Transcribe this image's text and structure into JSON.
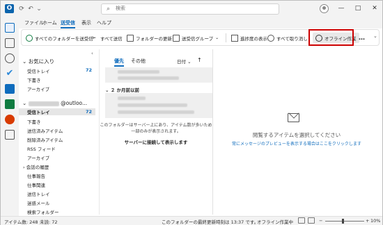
{
  "menu": [
    "ファイル",
    "ホーム",
    "送受信",
    "表示",
    "ヘルプ"
  ],
  "search": {
    "placeholder": "検索"
  },
  "ribbon": {
    "send_receive_all": "すべてのフォルダーを送受信",
    "send_all": "すべて送信",
    "update_folder": "フォルダーの更新",
    "send_receive_group": "送受信グループ",
    "show_progress": "進捗度の表示",
    "cancel_all": "すべて取り消し",
    "work_offline": "オフライン作業",
    "more": "…"
  },
  "folders": {
    "favorites_header": "お気に入り",
    "favorites": [
      {
        "label": "受信トレイ",
        "count": "72"
      },
      {
        "label": "下書き",
        "count": ""
      },
      {
        "label": "アーカイブ",
        "count": ""
      }
    ],
    "account_suffix": "@outloo...",
    "account_items": [
      {
        "label": "受信トレイ",
        "count": "72"
      },
      {
        "label": "下書き"
      },
      {
        "label": "送信済みアイテム"
      },
      {
        "label": "削除済みアイテム"
      },
      {
        "label": "RSS フィード"
      },
      {
        "label": "アーカイブ"
      },
      {
        "label": "会話の履歴"
      },
      {
        "label": "仕事報告"
      },
      {
        "label": "仕事関連"
      },
      {
        "label": "送信トレイ"
      },
      {
        "label": "迷惑メール"
      },
      {
        "label": "検索フォルダー"
      }
    ]
  },
  "list": {
    "tab_focused": "優先",
    "tab_other": "その他",
    "sort": "日付",
    "section_two_months": "２ か月前以前",
    "note_line1": "このフォルダーはサーバー上にあり、アイテム数が多いため",
    "note_line2": "一部のみが表示されます。",
    "connect": "サーバーに接続して表示します"
  },
  "reading": {
    "title": "閲覧するアイテムを選択してください",
    "link": "常にメッセージのプレビューを表示する場合はここをクリックします"
  },
  "status": {
    "items": "アイテム数: 248",
    "unread": "未読: 72",
    "last_update": "このフォルダーの最終更新時刻は 13:37 です。",
    "offline": "オフライン作業中",
    "zoom": "10%"
  },
  "colors": {
    "accent": "#0f6cbd",
    "highlight": "#cc0000"
  }
}
